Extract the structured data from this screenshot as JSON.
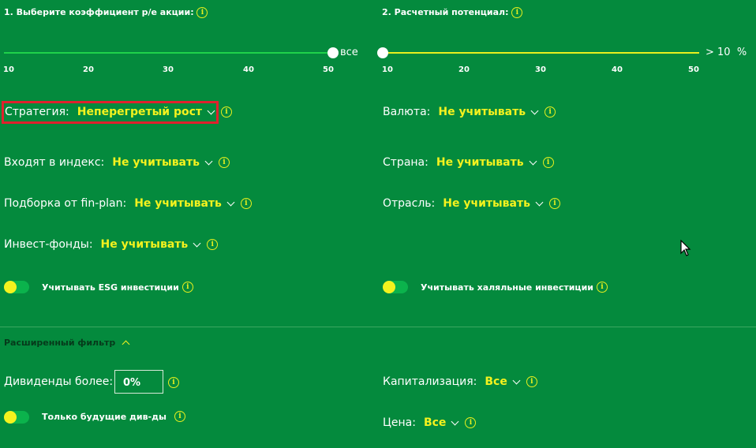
{
  "pe_slider": {
    "title": "1. Выберите коэффициент p/e акции:",
    "end_label": "все",
    "ticks": [
      "10",
      "20",
      "30",
      "40",
      "50"
    ],
    "selected_value": "все"
  },
  "potential_slider": {
    "title": "2. Расчетный потенциал:",
    "end_label": "> 10  %",
    "ticks": [
      "10",
      "20",
      "30",
      "40",
      "50"
    ],
    "selected_value": "10"
  },
  "filters": {
    "strategy": {
      "label": "Стратегия:",
      "value": "Неперегретый рост"
    },
    "index": {
      "label": "Входят в индекс:",
      "value": "Не учитывать"
    },
    "fin_plan": {
      "label": "Подборка от fin-plan:",
      "value": "Не учитывать"
    },
    "invest_funds": {
      "label": "Инвест-фонды:",
      "value": "Не учитывать"
    },
    "currency": {
      "label": "Валюта:",
      "value": "Не учитывать"
    },
    "country": {
      "label": "Страна:",
      "value": "Не учитывать"
    },
    "industry": {
      "label": "Отрасль:",
      "value": "Не учитывать"
    }
  },
  "toggles": {
    "esg": {
      "label": "Учитывать ESG инвестиции",
      "on": false
    },
    "halal": {
      "label": "Учитывать халяльные инвестиции",
      "on": false
    },
    "future_divs": {
      "label": "Только будущие див-ды",
      "on": false
    }
  },
  "advanced": {
    "title": "Расширенный фильтр",
    "dividends": {
      "label": "Дивиденды более:",
      "value": "0%"
    },
    "capitalization": {
      "label": "Капитализация:",
      "value": "Все"
    },
    "price": {
      "label": "Цена:",
      "value": "Все"
    }
  },
  "icons": {
    "info": "i"
  },
  "colors": {
    "background": "#048a3d",
    "accent": "#f4f21e",
    "highlight": "#e0212d"
  }
}
